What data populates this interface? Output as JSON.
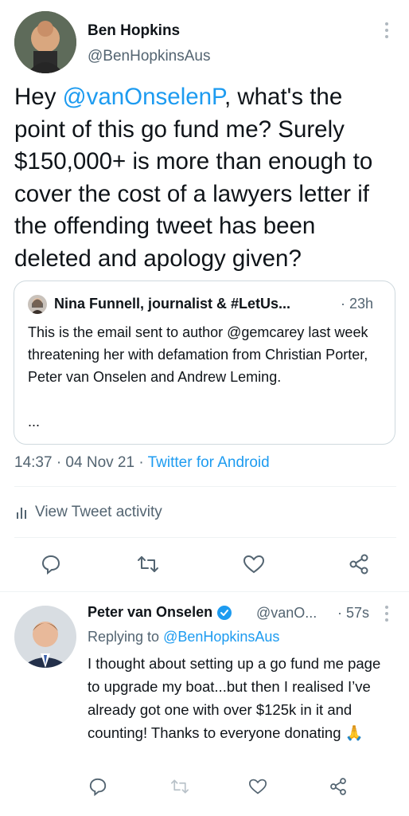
{
  "main_tweet": {
    "author_name": "Ben Hopkins",
    "author_handle": "@BenHopkinsAus",
    "text_prefix": "Hey ",
    "text_mention": "@vanOnselenP",
    "text_rest": ", what's the point of this go fund me? Surely $150,000+ is more than enough to cover the cost of a lawyers letter if the offending tweet has been deleted and apology given?",
    "quote": {
      "author_name": "Nina Funnell, journalist & #LetUs...",
      "time": "· 23h",
      "text": "This is the email sent to author @gemcarey last week threatening her with defamation from Christian Porter, Peter van Onselen and Andrew Leming.",
      "ellipsis": "..."
    },
    "timestamp": "14:37 · 04 Nov 21 · ",
    "source": "Twitter for Android",
    "activity_label": "View Tweet activity"
  },
  "reply_tweet": {
    "author_name": "Peter van Onselen",
    "author_handle": "@vanO...",
    "time": "· 57s",
    "replying_label": "Replying to ",
    "replying_handle": "@BenHopkinsAus",
    "text": "I thought about setting up a go fund me page to upgrade my boat...but then I realised I’ve already got one with over $125k in it and counting! Thanks to everyone donating",
    "emoji": "🙏"
  },
  "colors": {
    "accent": "#1d9bf0",
    "verified": "#1d9bf0",
    "secondary_text": "#536471"
  }
}
